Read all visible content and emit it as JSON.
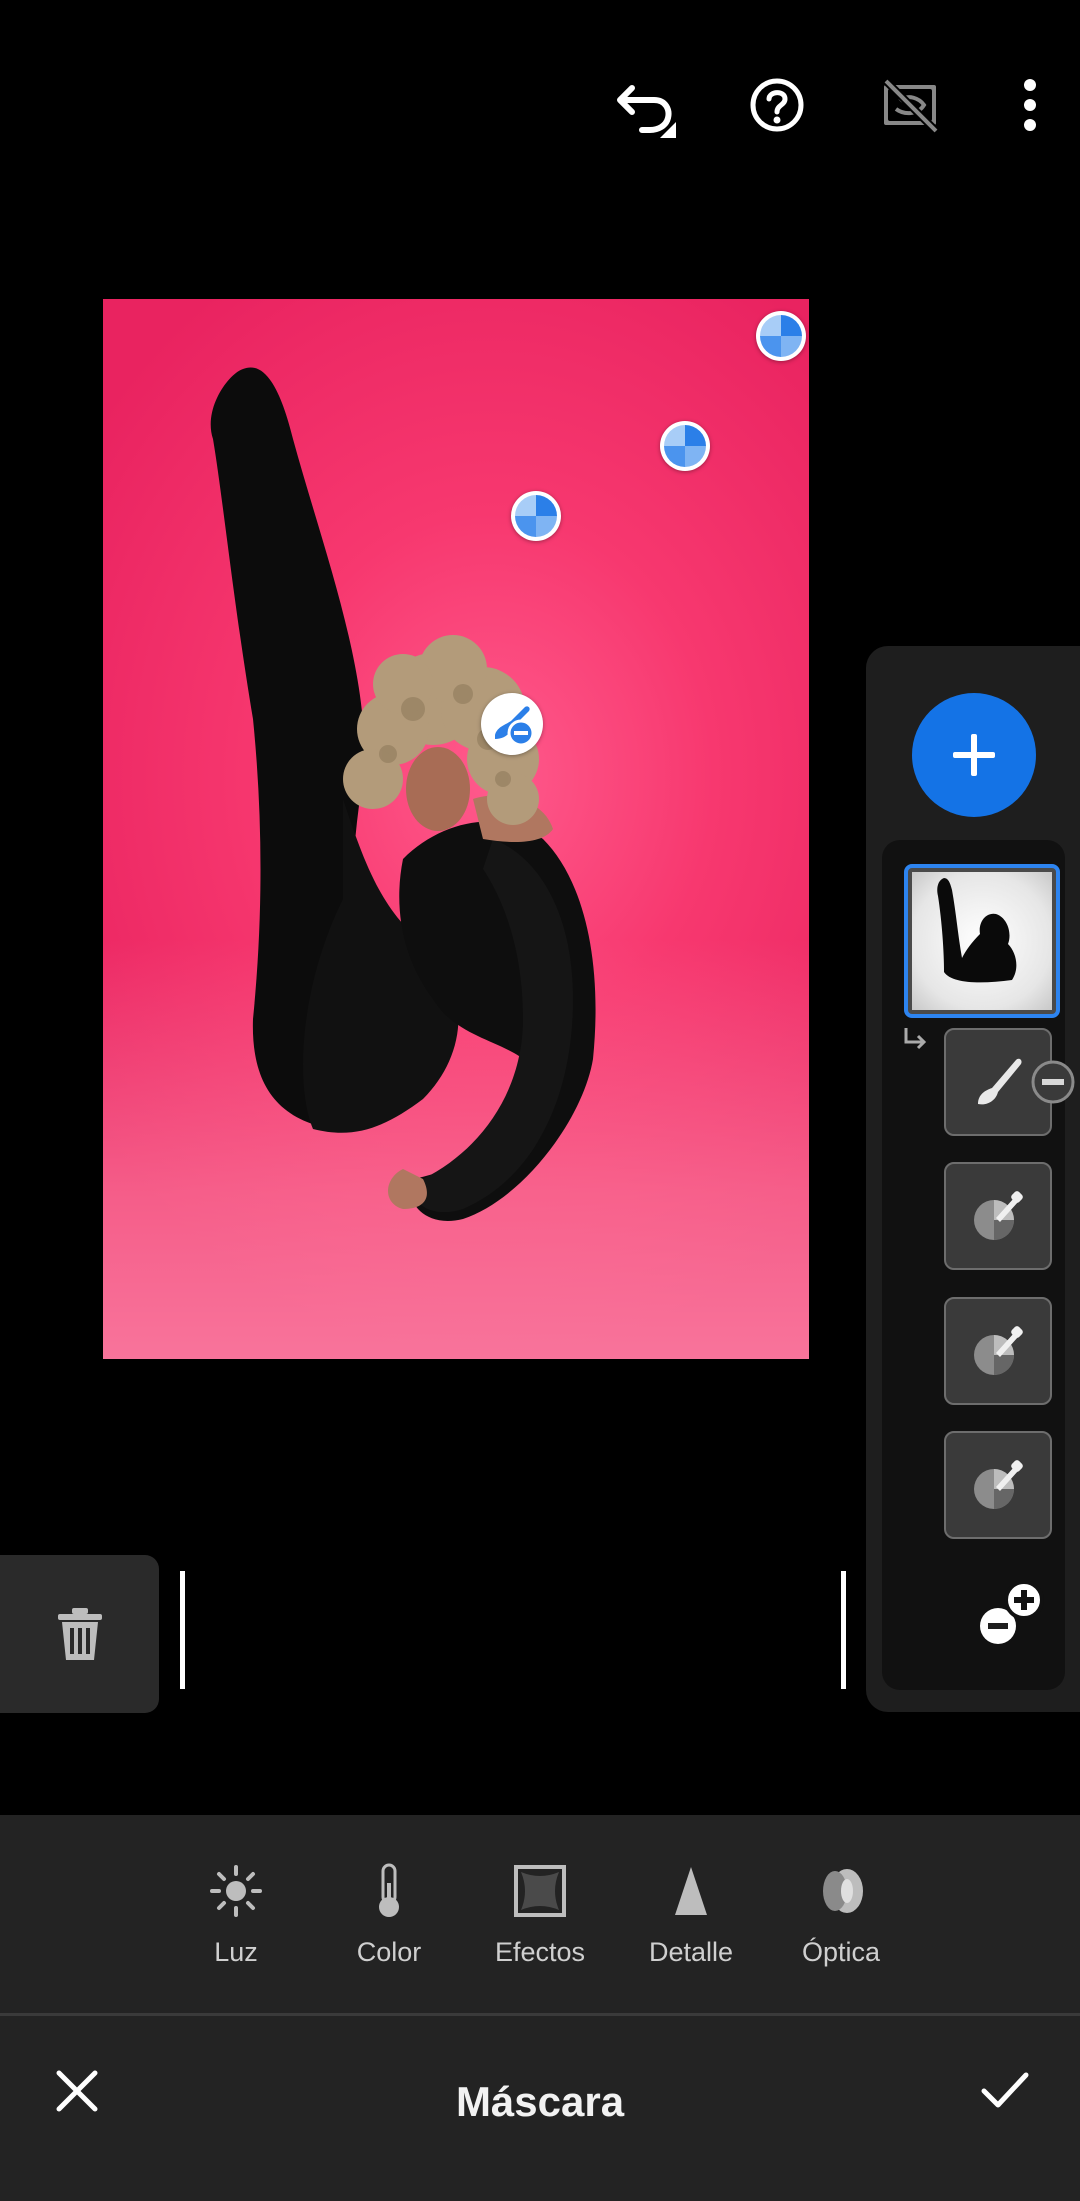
{
  "header": {
    "icons": [
      "undo-icon",
      "help-icon",
      "hide-overlay-icon",
      "more-options-icon"
    ]
  },
  "tools": [
    {
      "label": "Luz",
      "icon": "sun-icon"
    },
    {
      "label": "Color",
      "icon": "thermometer-icon"
    },
    {
      "label": "Efectos",
      "icon": "vignette-icon"
    },
    {
      "label": "Detalle",
      "icon": "triangle-icon"
    },
    {
      "label": "Óptica",
      "icon": "lens-icon"
    }
  ],
  "footer": {
    "title": "Máscara"
  },
  "colors": {
    "accent": "#1473e6",
    "background": "#000000",
    "panel": "#232323"
  }
}
